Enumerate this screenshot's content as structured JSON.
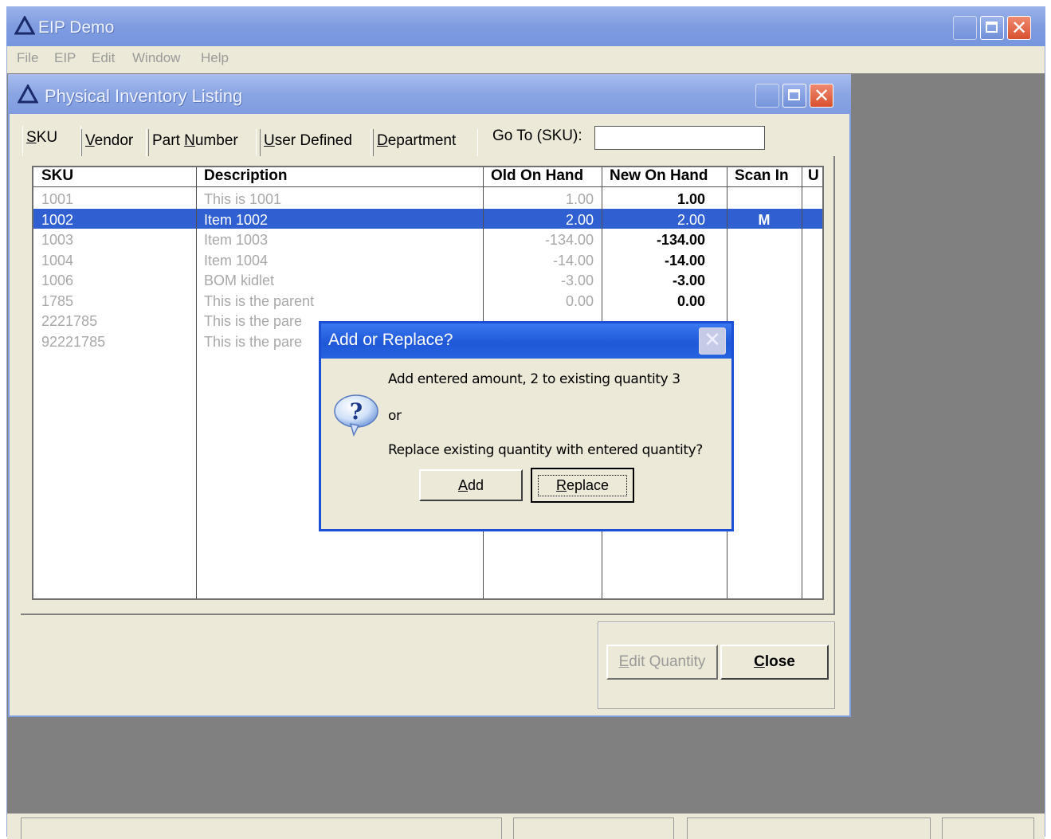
{
  "app": {
    "title": "EIP Demo",
    "menu": [
      "File",
      "EIP",
      "Edit",
      "Window",
      "Help"
    ]
  },
  "inventory_window": {
    "title": "Physical Inventory Listing",
    "tabs": [
      {
        "label": "SKU",
        "key": "S"
      },
      {
        "label": "Vendor",
        "key": "V"
      },
      {
        "label": "Part Number",
        "key": "N"
      },
      {
        "label": "User Defined",
        "key": "U"
      },
      {
        "label": "Department",
        "key": "D"
      }
    ],
    "goto_label": "Go To (SKU):",
    "goto_value": "",
    "columns": [
      "SKU",
      "Description",
      "Old On Hand",
      "New On Hand",
      "Scan In",
      "U"
    ],
    "rows": [
      {
        "sku": "1001",
        "description": "This is 1001",
        "old": "1.00",
        "new": "1.00",
        "scan": ""
      },
      {
        "sku": "1002",
        "description": "Item 1002",
        "old": "2.00",
        "new": "2.00",
        "scan": "M"
      },
      {
        "sku": "1003",
        "description": "Item 1003",
        "old": "-134.00",
        "new": "-134.00",
        "scan": ""
      },
      {
        "sku": "1004",
        "description": "Item 1004",
        "old": "-14.00",
        "new": "-14.00",
        "scan": ""
      },
      {
        "sku": "1006",
        "description": "BOM kidlet",
        "old": "-3.00",
        "new": "-3.00",
        "scan": ""
      },
      {
        "sku": "1785",
        "description": "This is the parent",
        "old": "0.00",
        "new": "0.00",
        "scan": ""
      },
      {
        "sku": "2221785",
        "description": "This is the pare",
        "old": "",
        "new": "",
        "scan": ""
      },
      {
        "sku": "92221785",
        "description": "This is the pare",
        "old": "",
        "new": "",
        "scan": ""
      }
    ],
    "selected_row": 1,
    "buttons": {
      "edit_quantity": "Edit Quantity",
      "close": "Close"
    }
  },
  "dialog": {
    "title": "Add or Replace?",
    "line1": "Add entered amount, 2 to existing quantity 3",
    "line2": "or",
    "line3": "Replace existing quantity with entered quantity?",
    "add_label": "Add",
    "replace_label": "Replace"
  },
  "colors": {
    "title_bar": "#7f9ce0",
    "dialog_title": "#1f58d8",
    "selection": "#2f5fd0",
    "window_face": "#ece9d8"
  }
}
